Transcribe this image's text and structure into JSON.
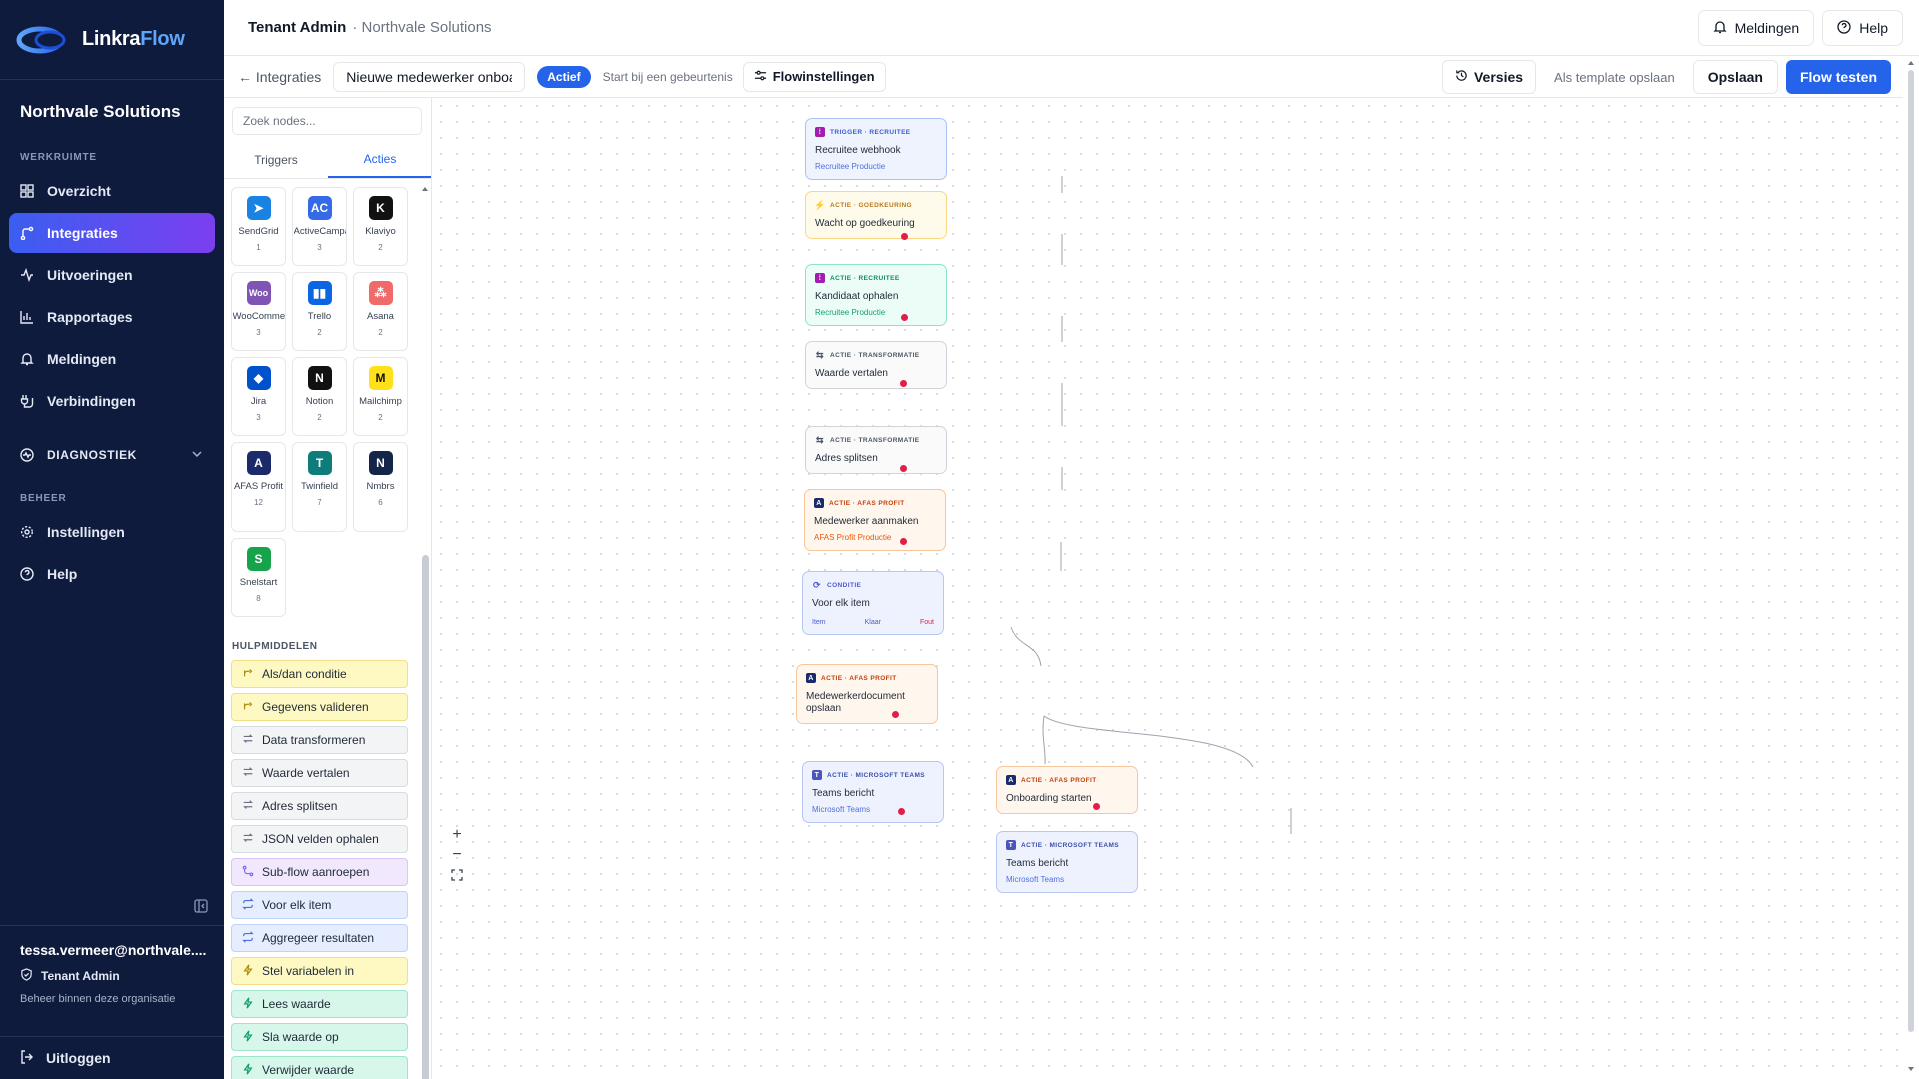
{
  "brand": {
    "name_part1": "Linkra",
    "name_part2": "Flow"
  },
  "sidebar": {
    "org": "Northvale Solutions",
    "section_werkruimte": "WERKRUIMTE",
    "items": [
      {
        "label": "Overzicht",
        "icon": "grid-icon"
      },
      {
        "label": "Integraties",
        "icon": "branch-icon"
      },
      {
        "label": "Uitvoeringen",
        "icon": "activity-icon"
      },
      {
        "label": "Rapportages",
        "icon": "bar-chart-icon"
      },
      {
        "label": "Meldingen",
        "icon": "bell-icon"
      },
      {
        "label": "Verbindingen",
        "icon": "plug-icon"
      }
    ],
    "diagnostiek": "DIAGNOSTIEK",
    "section_beheer": "BEHEER",
    "beheer_items": [
      {
        "label": "Instellingen",
        "icon": "gear-icon"
      },
      {
        "label": "Help",
        "icon": "help-circle-icon"
      }
    ],
    "user": {
      "email": "tessa.vermeer@northvale....",
      "role": "Tenant Admin",
      "hint": "Beheer binnen deze organisatie"
    },
    "logout": "Uitloggen"
  },
  "topbar": {
    "title": "Tenant Admin",
    "subtitle": "· Northvale Solutions",
    "meldingen": "Meldingen",
    "help": "Help"
  },
  "toolbar": {
    "back": "← Integraties",
    "flow_name": "Nieuwe medewerker onboarding",
    "status": "Actief",
    "start_event": "Start bij een gebeurtenis",
    "flow_settings": "Flowinstellingen",
    "versions": "Versies",
    "save_template": "Als template opslaan",
    "save": "Opslaan",
    "test": "Flow testen"
  },
  "palette": {
    "search_placeholder": "Zoek nodes...",
    "tabs": [
      "Triggers",
      "Acties"
    ],
    "active_tab": "Acties",
    "tiles": [
      {
        "name": "SendGrid",
        "count": "1",
        "color": "#1a82e2",
        "glyph": "➤"
      },
      {
        "name": "ActiveCampaign",
        "count": "3",
        "color": "#356ae6",
        "glyph": "AC"
      },
      {
        "name": "Klaviyo",
        "count": "2",
        "color": "#111111",
        "glyph": "K"
      },
      {
        "name": "WooCommerce",
        "count": "3",
        "color": "#7f54b3",
        "glyph": "Woo"
      },
      {
        "name": "Trello",
        "count": "2",
        "color": "#0c66e4",
        "glyph": "▮▮"
      },
      {
        "name": "Asana",
        "count": "2",
        "color": "#f06a6a",
        "glyph": "⁂"
      },
      {
        "name": "Jira",
        "count": "3",
        "color": "#0052cc",
        "glyph": "◆"
      },
      {
        "name": "Notion",
        "count": "2",
        "color": "#111111",
        "glyph": "N"
      },
      {
        "name": "Mailchimp",
        "count": "2",
        "color": "#ffe01b",
        "glyph": "M"
      },
      {
        "name": "AFAS Profit",
        "count": "12",
        "color": "#1b2a6b",
        "glyph": "A"
      },
      {
        "name": "Twinfield",
        "count": "7",
        "color": "#0e7c7b",
        "glyph": "T"
      },
      {
        "name": "Nmbrs",
        "count": "6",
        "color": "#14254a",
        "glyph": "N"
      },
      {
        "name": "Snelstart",
        "count": "8",
        "color": "#16a34a",
        "glyph": "S"
      }
    ],
    "hulp_title": "HULPMIDDELEN",
    "hulp": [
      {
        "label": "Als/dan conditie",
        "style": "yel",
        "icon": "branch-icon"
      },
      {
        "label": "Gegevens valideren",
        "style": "yel",
        "icon": "branch-icon"
      },
      {
        "label": "Data transformeren",
        "style": "gray",
        "icon": "arrows-icon"
      },
      {
        "label": "Waarde vertalen",
        "style": "gray",
        "icon": "arrows-icon"
      },
      {
        "label": "Adres splitsen",
        "style": "gray",
        "icon": "arrows-icon"
      },
      {
        "label": "JSON velden ophalen",
        "style": "gray",
        "icon": "arrows-icon"
      },
      {
        "label": "Sub-flow aanroepen",
        "style": "pur",
        "icon": "subflow-icon"
      },
      {
        "label": "Voor elk item",
        "style": "blue",
        "icon": "repeat-icon"
      },
      {
        "label": "Aggregeer resultaten",
        "style": "blue",
        "icon": "repeat-icon"
      },
      {
        "label": "Stel variabelen in",
        "style": "yel",
        "icon": "bolt-icon"
      },
      {
        "label": "Lees waarde",
        "style": "grn",
        "icon": "bolt-icon"
      },
      {
        "label": "Sla waarde op",
        "style": "grn",
        "icon": "bolt-icon"
      },
      {
        "label": "Verwijder waarde",
        "style": "grn",
        "icon": "bolt-icon"
      }
    ]
  },
  "nodes": [
    {
      "kind": "TRIGGER · RECRUITEE",
      "title": "Recruitee webhook",
      "sub": "Recruitee Productie",
      "style": "trig",
      "icon": "recruitee-icon"
    },
    {
      "kind": "ACTIE · GOEDKEURING",
      "title": "Wacht op goedkeuring",
      "sub": "",
      "style": "appr",
      "icon": "bolt-icon"
    },
    {
      "kind": "ACTIE · RECRUITEE",
      "title": "Kandidaat ophalen",
      "sub": "Recruitee Productie",
      "style": "recr",
      "icon": "recruitee-icon"
    },
    {
      "kind": "ACTIE · TRANSFORMATIE",
      "title": "Waarde vertalen",
      "sub": "",
      "style": "trans",
      "icon": "arrows-icon"
    },
    {
      "kind": "ACTIE · TRANSFORMATIE",
      "title": "Adres splitsen",
      "sub": "",
      "style": "trans",
      "icon": "arrows-icon"
    },
    {
      "kind": "ACTIE · AFAS PROFIT",
      "title": "Medewerker aanmaken",
      "sub": "AFAS Profit Productie",
      "style": "afas",
      "icon": "afas-icon"
    },
    {
      "kind": "CONDITIE",
      "title": "Voor elk item",
      "sub": "",
      "style": "cond",
      "icon": "repeat-icon",
      "ports": [
        "Item",
        "Klaar",
        "Fout"
      ]
    },
    {
      "kind": "ACTIE · AFAS PROFIT",
      "title": "Medewerkerdocument opslaan",
      "sub": "",
      "style": "afas",
      "icon": "afas-icon"
    },
    {
      "kind": "ACTIE · MICROSOFT TEAMS",
      "title": "Teams bericht",
      "sub": "Microsoft Teams",
      "style": "teams",
      "icon": "teams-icon"
    },
    {
      "kind": "ACTIE · AFAS PROFIT",
      "title": "Onboarding starten",
      "sub": "",
      "style": "afas",
      "icon": "afas-icon"
    },
    {
      "kind": "ACTIE · MICROSOFT TEAMS",
      "title": "Teams bericht",
      "sub": "Microsoft Teams",
      "style": "teams",
      "icon": "teams-icon"
    }
  ],
  "zoom_controls": {
    "zoom_in": "+",
    "zoom_out": "−"
  },
  "colors": {
    "sidebar_bg": "#0e1b3d",
    "primary": "#2563eb",
    "accent_gradient_end": "#7b3ff0",
    "error_port": "#e11d48"
  }
}
